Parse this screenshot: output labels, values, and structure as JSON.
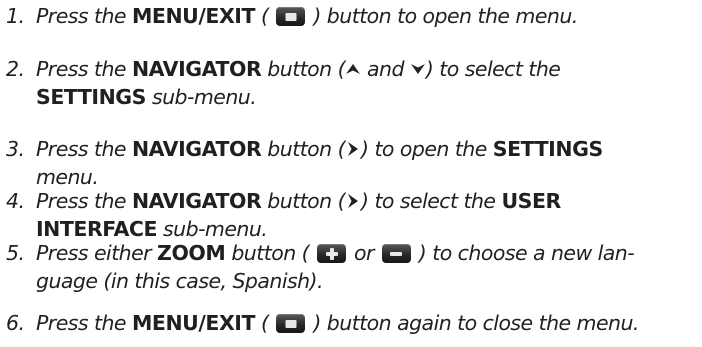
{
  "steps": [
    {
      "number": "1.",
      "lines": [
        [
          {
            "t": "text",
            "v": "Press the "
          },
          {
            "t": "bold",
            "v": "MENU/EXIT"
          },
          {
            "t": "text",
            "v": " ( "
          },
          {
            "t": "icon",
            "icon": "menu-exit-button-icon"
          },
          {
            "t": "text",
            "v": " ) button to open the menu."
          }
        ]
      ]
    },
    {
      "number": "2.",
      "lines": [
        [
          {
            "t": "text",
            "v": "Press the "
          },
          {
            "t": "bold",
            "v": "NAVIGATOR"
          },
          {
            "t": "text",
            "v": " button ("
          },
          {
            "t": "icon",
            "icon": "arrow-up-icon"
          },
          {
            "t": "text",
            "v": " and "
          },
          {
            "t": "icon",
            "icon": "arrow-down-icon"
          },
          {
            "t": "text",
            "v": ") to select the"
          }
        ],
        [
          {
            "t": "bold",
            "v": "SETTINGS"
          },
          {
            "t": "text",
            "v": " sub-menu."
          }
        ]
      ]
    },
    {
      "number": "3.",
      "lines": [
        [
          {
            "t": "text",
            "v": "Press the "
          },
          {
            "t": "bold",
            "v": "NAVIGATOR"
          },
          {
            "t": "text",
            "v": " button ("
          },
          {
            "t": "icon",
            "icon": "arrow-right-icon"
          },
          {
            "t": "text",
            "v": ") to open the "
          },
          {
            "t": "bold",
            "v": "SETTINGS"
          }
        ],
        [
          {
            "t": "text",
            "v": "menu."
          }
        ]
      ]
    },
    {
      "number": "4.",
      "lines": [
        [
          {
            "t": "text",
            "v": "Press the "
          },
          {
            "t": "bold",
            "v": "NAVIGATOR"
          },
          {
            "t": "text",
            "v": " button ("
          },
          {
            "t": "icon",
            "icon": "arrow-right-icon"
          },
          {
            "t": "text",
            "v": ") to select the "
          },
          {
            "t": "bold",
            "v": "USER"
          }
        ],
        [
          {
            "t": "bold",
            "v": "INTERFACE"
          },
          {
            "t": "text",
            "v": " sub-menu."
          }
        ]
      ]
    },
    {
      "number": "5.",
      "lines": [
        [
          {
            "t": "text",
            "v": "Press either "
          },
          {
            "t": "bold",
            "v": "ZOOM"
          },
          {
            "t": "text",
            "v": " button ( "
          },
          {
            "t": "icon",
            "icon": "zoom-plus-button-icon"
          },
          {
            "t": "text",
            "v": " or "
          },
          {
            "t": "icon",
            "icon": "zoom-minus-button-icon"
          },
          {
            "t": "text",
            "v": " ) to choose a new lan-"
          }
        ],
        [
          {
            "t": "text",
            "v": "guage (in this case, Spanish)."
          }
        ]
      ]
    },
    {
      "number": "6.",
      "lines": [
        [
          {
            "t": "text",
            "v": "Press the "
          },
          {
            "t": "bold",
            "v": "MENU/EXIT"
          },
          {
            "t": "text",
            "v": " ( "
          },
          {
            "t": "icon",
            "icon": "menu-exit-button-icon"
          },
          {
            "t": "text",
            "v": " ) button again to close the menu."
          }
        ]
      ]
    }
  ]
}
